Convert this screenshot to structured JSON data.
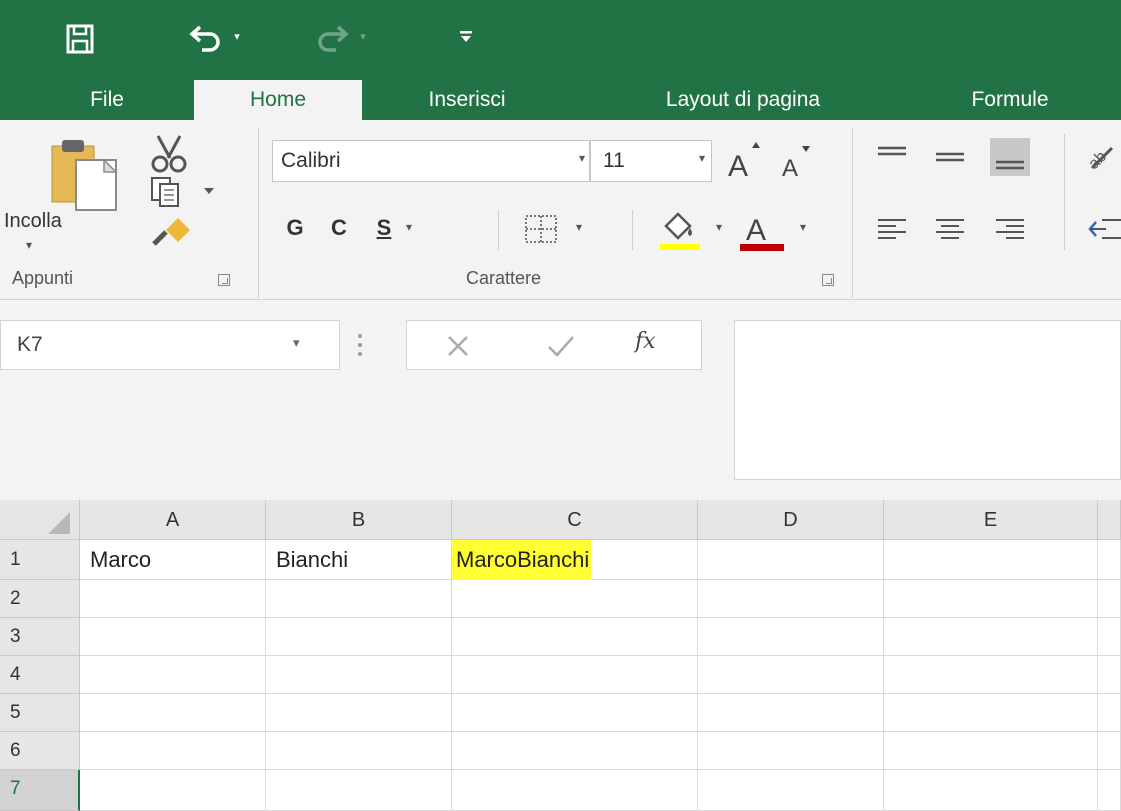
{
  "title_bar": {
    "bg_color": "#217346",
    "quick_access": {
      "save_icon": "save-icon",
      "undo_icon": "undo-icon",
      "redo_icon": "redo-icon",
      "dropdown_glyph": "▾",
      "customize_glyph": "⩡"
    }
  },
  "tabs": [
    {
      "label": "File"
    },
    {
      "label": "Home",
      "active": true
    },
    {
      "label": "Inserisci"
    },
    {
      "label": "Layout di pagina"
    },
    {
      "label": "Formule"
    }
  ],
  "ribbon": {
    "clipboard": {
      "paste_label": "Incolla",
      "group_label": "Appunti"
    },
    "font": {
      "name": "Calibri",
      "size": "11",
      "bold_label": "G",
      "italic_label": "C",
      "underline_label": "S",
      "group_label": "Carattere",
      "fill_color": "#ffff00",
      "font_color": "#c00000"
    }
  },
  "formula_bar": {
    "name_box": "K7",
    "fx_label": "fx",
    "formula": ""
  },
  "sheet": {
    "columns": [
      "A",
      "B",
      "C",
      "D",
      "E"
    ],
    "rows": [
      "1",
      "2",
      "3",
      "4",
      "5",
      "6",
      "7"
    ],
    "active_row": "7",
    "cells": {
      "A1": "Marco",
      "B1": "Bianchi",
      "C1": "MarcoBianchi"
    },
    "highlight_color": "#ffff33"
  }
}
